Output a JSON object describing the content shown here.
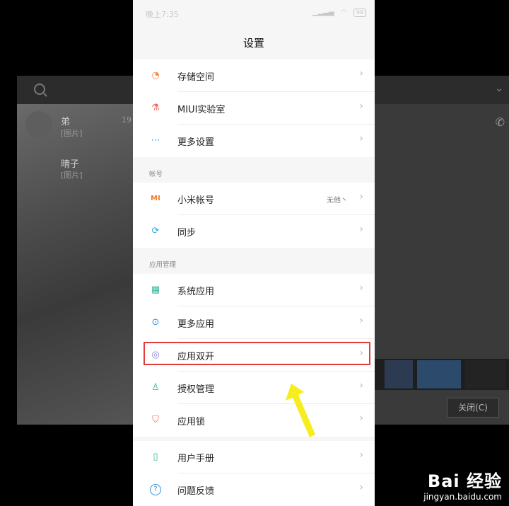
{
  "background_window": {
    "contacts": [
      {
        "name": "弟",
        "sub": "[图片]"
      },
      {
        "name": "晴子",
        "sub": "[图片]"
      }
    ],
    "partial_number": "19",
    "close_button": "关闭(C)"
  },
  "status_bar": {
    "time": "晚上7:35",
    "battery": "99"
  },
  "settings": {
    "title": "设置",
    "groups": [
      {
        "header": "",
        "items": [
          {
            "label": "存储空间",
            "icon": "storage-icon",
            "icon_glyph": "◔",
            "icon_color": "#f08a4b",
            "value": ""
          },
          {
            "label": "MIUI实验室",
            "icon": "lab-flask-icon",
            "icon_glyph": "⚗",
            "icon_color": "#f0665f",
            "value": ""
          },
          {
            "label": "更多设置",
            "icon": "more-dots-icon",
            "icon_glyph": "⋯",
            "icon_color": "#2fa8e0",
            "value": ""
          }
        ]
      },
      {
        "header": "帐号",
        "items": [
          {
            "label": "小米帐号",
            "icon": "mi-logo-icon",
            "icon_glyph": "MI",
            "icon_color": "#f47a2a",
            "value": "无他丶"
          },
          {
            "label": "同步",
            "icon": "sync-icon",
            "icon_glyph": "⟳",
            "icon_color": "#2fa8e0",
            "value": ""
          }
        ]
      },
      {
        "header": "应用管理",
        "items": [
          {
            "label": "系统应用",
            "icon": "grid-apps-icon",
            "icon_glyph": "▦",
            "icon_color": "#35b89a",
            "value": ""
          },
          {
            "label": "更多应用",
            "icon": "more-apps-icon",
            "icon_glyph": "⊙",
            "icon_color": "#2f8fe0",
            "value": ""
          },
          {
            "label": "应用双开",
            "icon": "dual-apps-icon",
            "icon_glyph": "◎",
            "icon_color": "#8a7fe0",
            "value": ""
          },
          {
            "label": "授权管理",
            "icon": "permission-icon",
            "icon_glyph": "♙",
            "icon_color": "#35b89a",
            "value": ""
          },
          {
            "label": "应用锁",
            "icon": "app-lock-icon",
            "icon_glyph": "⛉",
            "icon_color": "#f0665f",
            "value": ""
          }
        ]
      },
      {
        "header": "",
        "items": [
          {
            "label": "用户手册",
            "icon": "manual-icon",
            "icon_glyph": "▯",
            "icon_color": "#35b89a",
            "value": ""
          },
          {
            "label": "问题反馈",
            "icon": "feedback-icon",
            "icon_glyph": "?",
            "icon_color": "#2f8fe0",
            "value": ""
          }
        ]
      }
    ]
  },
  "chevron_glyph": "›",
  "highlight_color": "#e53a3a",
  "arrow_color": "#f7ec1c",
  "watermark": {
    "logo": "Bai 经验",
    "url": "jingyan.baidu.com"
  }
}
